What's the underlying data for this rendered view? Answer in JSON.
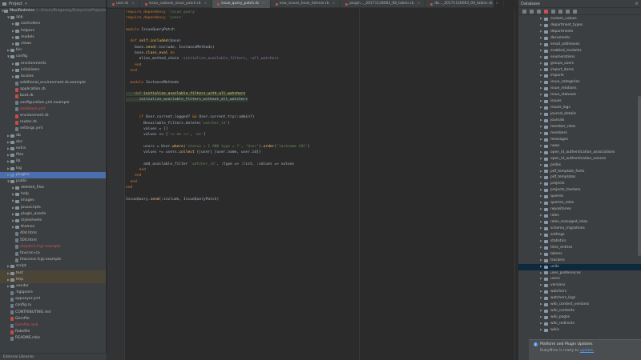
{
  "project_panel": {
    "title": "Project",
    "root": "MaxiRedmine",
    "root_path": "(~/Users/Bragaway/RubymineProjects/...)",
    "external": "External Libraries",
    "bottom_label": "< Rbenvsmine(ISE-p112 )> ~/rbenv/versions/..."
  },
  "tree": [
    {
      "label": "app",
      "depth": 1,
      "open": true,
      "type": "folder"
    },
    {
      "label": "controllers",
      "depth": 2,
      "open": false,
      "type": "folder"
    },
    {
      "label": "helpers",
      "depth": 2,
      "open": false,
      "type": "folder"
    },
    {
      "label": "models",
      "depth": 2,
      "open": false,
      "type": "folder"
    },
    {
      "label": "views",
      "depth": 2,
      "open": false,
      "type": "folder"
    },
    {
      "label": "bin",
      "depth": 1,
      "open": false,
      "type": "folder"
    },
    {
      "label": "config",
      "depth": 1,
      "open": true,
      "type": "folder"
    },
    {
      "label": "environments",
      "depth": 2,
      "open": false,
      "type": "folder"
    },
    {
      "label": "initializers",
      "depth": 2,
      "open": false,
      "type": "folder"
    },
    {
      "label": "locales",
      "depth": 2,
      "open": false,
      "type": "folder"
    },
    {
      "label": "additional_environment.rb.example",
      "depth": 2,
      "type": "file"
    },
    {
      "label": "application.rb",
      "depth": 2,
      "type": "rb"
    },
    {
      "label": "boot.rb",
      "depth": 2,
      "type": "rb"
    },
    {
      "label": "configuration.yml.example",
      "depth": 2,
      "type": "file"
    },
    {
      "label": "database.yml",
      "depth": 2,
      "type": "file",
      "red": true
    },
    {
      "label": "environment.rb",
      "depth": 2,
      "type": "rb"
    },
    {
      "label": "routes.rb",
      "depth": 2,
      "type": "rb"
    },
    {
      "label": "settings.yml",
      "depth": 2,
      "type": "file"
    },
    {
      "label": "db",
      "depth": 1,
      "open": false,
      "type": "folder"
    },
    {
      "label": "doc",
      "depth": 1,
      "open": false,
      "type": "folder"
    },
    {
      "label": "extra",
      "depth": 1,
      "open": false,
      "type": "folder"
    },
    {
      "label": "files",
      "depth": 1,
      "open": false,
      "type": "folder"
    },
    {
      "label": "lib",
      "depth": 1,
      "open": false,
      "type": "folder"
    },
    {
      "label": "log",
      "depth": 1,
      "open": false,
      "type": "folder"
    },
    {
      "label": "plugins",
      "depth": 1,
      "open": false,
      "type": "folder",
      "selected": true
    },
    {
      "label": "public",
      "depth": 1,
      "open": true,
      "type": "folder"
    },
    {
      "label": "deleted_files",
      "depth": 2,
      "open": false,
      "type": "folder"
    },
    {
      "label": "help",
      "depth": 2,
      "open": false,
      "type": "folder"
    },
    {
      "label": "images",
      "depth": 2,
      "open": false,
      "type": "folder"
    },
    {
      "label": "javascripts",
      "depth": 2,
      "open": false,
      "type": "folder"
    },
    {
      "label": "plugin_assets",
      "depth": 2,
      "open": false,
      "type": "folder"
    },
    {
      "label": "stylesheets",
      "depth": 2,
      "open": false,
      "type": "folder"
    },
    {
      "label": "themes",
      "depth": 2,
      "open": false,
      "type": "folder"
    },
    {
      "label": "404.html",
      "depth": 2,
      "type": "file"
    },
    {
      "label": "500.html",
      "depth": 2,
      "type": "file"
    },
    {
      "label": "dispatch.fcgi.example",
      "depth": 2,
      "type": "file",
      "red": true
    },
    {
      "label": "favicon.ico",
      "depth": 2,
      "type": "file"
    },
    {
      "label": "htaccess.fcgi.example",
      "depth": 2,
      "type": "file"
    },
    {
      "label": "script",
      "depth": 1,
      "open": false,
      "type": "folder"
    },
    {
      "label": "test",
      "depth": 1,
      "open": false,
      "type": "folder",
      "tan": true
    },
    {
      "label": "tmp",
      "depth": 1,
      "open": false,
      "type": "folder",
      "tan": true
    },
    {
      "label": "vendor",
      "depth": 1,
      "open": false,
      "type": "folder"
    },
    {
      "label": ".hgignore",
      "depth": 1,
      "type": "file"
    },
    {
      "label": "appveyor.yml",
      "depth": 1,
      "type": "file"
    },
    {
      "label": "config.ru",
      "depth": 1,
      "type": "file"
    },
    {
      "label": "CONTRIBUTING.md",
      "depth": 1,
      "type": "file"
    },
    {
      "label": "Gemfile",
      "depth": 1,
      "type": "rb"
    },
    {
      "label": "Gemfile.lock",
      "depth": 1,
      "type": "file",
      "red": true
    },
    {
      "label": "Rakefile",
      "depth": 1,
      "type": "rb"
    },
    {
      "label": "README.rdoc",
      "depth": 1,
      "type": "file"
    }
  ],
  "tabs": [
    {
      "label": "user.rb",
      "active": false
    },
    {
      "label": "issue_subtask_issue_patch.rb",
      "active": false
    },
    {
      "label": "issue_query_patch.rb",
      "active": true
    },
    {
      "label": "new_issues_hook_listener.rb",
      "active": false
    },
    {
      "label": "plugin…_20171128083_08_tables.rb",
      "active": false
    },
    {
      "label": "db…_20171128083_09_tables.rb",
      "active": false
    }
  ],
  "code": [
    [
      [
        "k",
        "require_dependency "
      ],
      [
        "s",
        "'issue_query'"
      ]
    ],
    [
      [
        "k",
        "require_dependency "
      ],
      [
        "s",
        "'users'"
      ]
    ],
    [],
    [
      [
        "k",
        "module "
      ],
      [
        "cn",
        "IssueQueryPatch"
      ]
    ],
    [],
    [
      [
        "k",
        "  def "
      ],
      [
        "m",
        "self.included"
      ],
      [
        "cn",
        "(base)"
      ]
    ],
    [
      [
        "cn",
        "    base."
      ],
      [
        "m",
        "send"
      ],
      [
        "cn",
        "(:include, "
      ],
      [
        "cn",
        "InstanceMethods"
      ],
      [
        "cn",
        ")"
      ]
    ],
    [
      [
        "cn",
        "    base."
      ],
      [
        "m",
        "class_eval "
      ],
      [
        "k",
        "do"
      ]
    ],
    [
      [
        "cn",
        "      alias_method_chain "
      ],
      [
        "sym",
        ":initialize_available_filters"
      ],
      [
        "cn",
        ", "
      ],
      [
        "sym",
        ":all_watchers"
      ]
    ],
    [
      [
        "k",
        "    end"
      ]
    ],
    [
      [
        "k",
        "  end"
      ]
    ],
    [],
    [
      [
        "k",
        "  module "
      ],
      [
        "cn",
        "InstanceMethods"
      ]
    ],
    [],
    [
      [
        "k",
        "    def "
      ],
      [
        "m",
        "initialize_available_filters_with_all_watchers"
      ],
      [
        "hl",
        ""
      ]
    ],
    [
      [
        "cn",
        "      initialize_available_filters_without_all_watchers"
      ],
      [
        "hl",
        ""
      ]
    ],
    [],
    [],
    [
      [
        "k",
        "      if "
      ],
      [
        "cn",
        "User.current.logged? "
      ],
      [
        "k",
        "&& "
      ],
      [
        "cn",
        "User.current.try(:admin?)"
      ]
    ],
    [
      [
        "cn",
        "        Bevailable_filters.delete("
      ],
      [
        "s",
        "'watcher_id'"
      ],
      [
        "cn",
        ")"
      ]
    ],
    [
      [
        "cn",
        "        values = []"
      ]
    ],
    [
      [
        "cn",
        "        values << ["
      ],
      [
        "s",
        "'<< me >>'"
      ],
      [
        "cn",
        ", "
      ],
      [
        "s",
        "'me'"
      ],
      [
        "cn",
        "]"
      ]
    ],
    [],
    [
      [
        "cn",
        "        users = User."
      ],
      [
        "m",
        "where"
      ],
      [
        "cn",
        "("
      ],
      [
        "s",
        "'status = 1 AND type = ?'"
      ],
      [
        "cn",
        ", "
      ],
      [
        "s",
        "'User'"
      ],
      [
        "cn",
        ")."
      ],
      [
        "m",
        "order"
      ],
      [
        "cn",
        "("
      ],
      [
        "s",
        "'lastname ASC'"
      ],
      [
        "cn",
        ")"
      ]
    ],
    [
      [
        "cn",
        "        values += users."
      ],
      [
        "m",
        "collect"
      ],
      [
        "cn",
        " {|user| [user.name, user.id]}"
      ]
    ],
    [],
    [
      [
        "cn",
        "        add_available_filter "
      ],
      [
        "s",
        "'watcher_id'"
      ],
      [
        "cn",
        ", :type => :list, :values => values"
      ]
    ],
    [
      [
        "k",
        "      end"
      ]
    ],
    [
      [
        "k",
        "    end"
      ]
    ],
    [
      [
        "k",
        "  end"
      ]
    ],
    [
      [
        "k",
        "end"
      ]
    ],
    [],
    [
      [
        "cn",
        "IssueQuery."
      ],
      [
        "m",
        "send"
      ],
      [
        "cn",
        "(:include, "
      ],
      [
        "cn",
        "IssueQueryPatch"
      ],
      [
        "cn",
        ")"
      ]
    ]
  ],
  "db_panel": {
    "title": "Database",
    "tables": [
      "custom_values",
      "department_types",
      "departments",
      "documents",
      "email_addresses",
      "enabled_modules",
      "enumerations",
      "groups_users",
      "import_items",
      "imports",
      "issue_categories",
      "issue_relations",
      "issue_statuses",
      "issues",
      "issues_logs",
      "journal_details",
      "journals",
      "member_roles",
      "members",
      "messages",
      "news",
      "open_id_authentication_associations",
      "open_id_authentication_nonces",
      "pollos",
      "pdf_template_fonts",
      "pdf_templates",
      "projects",
      "projects_trackers",
      "queries",
      "queries_roles",
      "repositories",
      "roles",
      "roles_managed_roles",
      "schema_migrations",
      "settings",
      "statistics",
      "time_entries",
      "tokens",
      "trackers",
      "units",
      "user_preferences",
      "users",
      "versions",
      "watchers",
      "watchers_logs",
      "wiki_content_versions",
      "wiki_contents",
      "wiki_pages",
      "wiki_redirects",
      "wikis"
    ],
    "selected": "units"
  },
  "notification": {
    "title": "Platform and Plugin Updates",
    "body": "RubyMine is ready to",
    "link": "update."
  }
}
